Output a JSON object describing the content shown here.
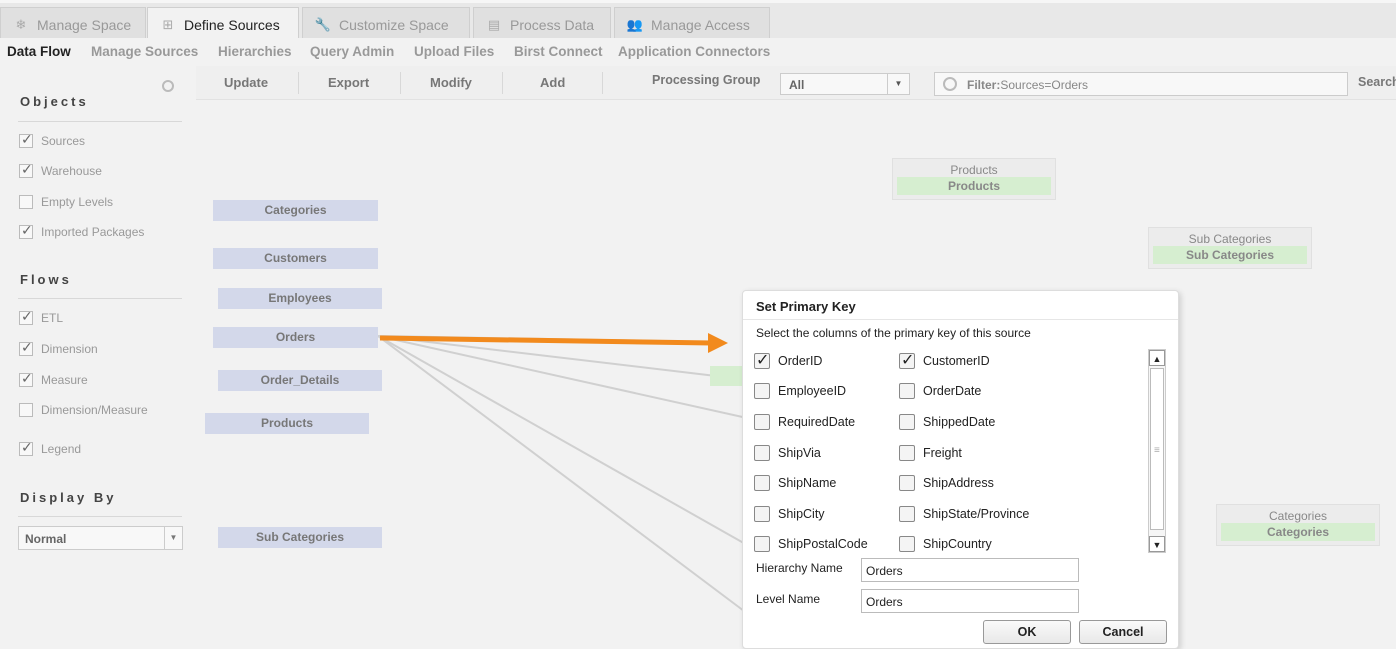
{
  "tabs": [
    {
      "label": "Manage Space",
      "icon": "snowflake-icon"
    },
    {
      "label": "Define Sources",
      "icon": "table-icon"
    },
    {
      "label": "Customize Space",
      "icon": "wrench-icon"
    },
    {
      "label": "Process Data",
      "icon": "database-icon"
    },
    {
      "label": "Manage Access",
      "icon": "users-icon"
    }
  ],
  "subnav": [
    "Data Flow",
    "Manage Sources",
    "Hierarchies",
    "Query Admin",
    "Upload Files",
    "Birst Connect",
    "Application Connectors"
  ],
  "left": {
    "objects_title": "Objects",
    "objects": [
      {
        "label": "Sources",
        "checked": true
      },
      {
        "label": "Warehouse",
        "checked": true
      },
      {
        "label": "Empty Levels",
        "checked": false
      },
      {
        "label": "Imported Packages",
        "checked": true
      }
    ],
    "flows_title": "Flows",
    "flows": [
      {
        "label": "ETL",
        "checked": true
      },
      {
        "label": "Dimension",
        "checked": true
      },
      {
        "label": "Measure",
        "checked": true
      },
      {
        "label": "Dimension/Measure",
        "checked": false
      }
    ],
    "legend": {
      "label": "Legend",
      "checked": true
    },
    "display_title": "Display By",
    "display_value": "Normal"
  },
  "toolbar": {
    "update": "Update",
    "export": "Export",
    "modify": "Modify",
    "add": "Add",
    "processing_group_label": "Processing Group",
    "processing_group_value": "All",
    "filter_label": "Filter:",
    "filter_value": "Sources=Orders",
    "search_label": "Search"
  },
  "canvas": {
    "sources": [
      "Categories",
      "Customers",
      "Employees",
      "Orders",
      "Order_Details",
      "Products",
      "Sub Categories"
    ],
    "cards": [
      {
        "title": "Products",
        "name": "Products"
      },
      {
        "title": "Sub Categories",
        "name": "Sub Categories"
      },
      {
        "title": "Categories",
        "name": "Categories"
      }
    ]
  },
  "dialog": {
    "title": "Set Primary Key",
    "subtitle": "Select the columns of the primary key of this source",
    "columns": [
      {
        "label": "OrderID",
        "checked": true
      },
      {
        "label": "CustomerID",
        "checked": true
      },
      {
        "label": "EmployeeID",
        "checked": false
      },
      {
        "label": "OrderDate",
        "checked": false
      },
      {
        "label": "RequiredDate",
        "checked": false
      },
      {
        "label": "ShippedDate",
        "checked": false
      },
      {
        "label": "ShipVia",
        "checked": false
      },
      {
        "label": "Freight",
        "checked": false
      },
      {
        "label": "ShipName",
        "checked": false
      },
      {
        "label": "ShipAddress",
        "checked": false
      },
      {
        "label": "ShipCity",
        "checked": false
      },
      {
        "label": "ShipState/Province",
        "checked": false
      },
      {
        "label": "ShipPostalCode",
        "checked": false
      },
      {
        "label": "ShipCountry",
        "checked": false
      }
    ],
    "hierarchy_label": "Hierarchy Name",
    "hierarchy_value": "Orders",
    "level_label": "Level Name",
    "level_value": "Orders",
    "ok": "OK",
    "cancel": "Cancel"
  },
  "colors": {
    "accent_arrow": "#f28a1d",
    "source_node": "#d3d8ea",
    "warehouse_node": "#d6eed0"
  }
}
